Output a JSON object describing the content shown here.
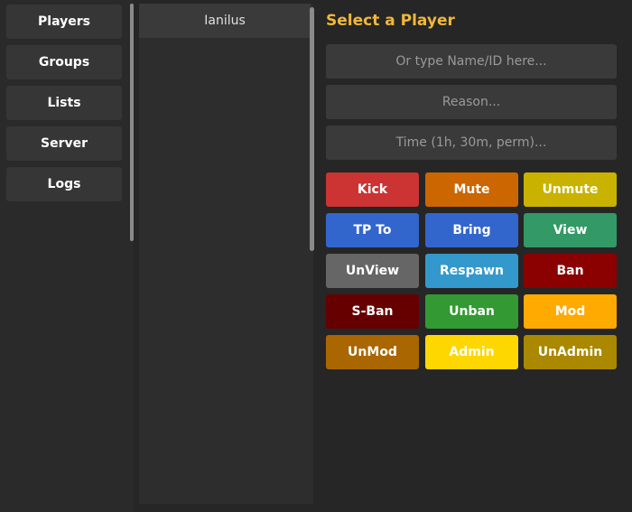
{
  "nav": {
    "players": "Players",
    "groups": "Groups",
    "lists": "Lists",
    "server": "Server",
    "logs": "Logs"
  },
  "players": [
    "Ianilus"
  ],
  "panel": {
    "title": "Select a Player",
    "target_placeholder": "Or type Name/ID here...",
    "reason_placeholder": "Reason...",
    "time_placeholder": "Time (1h, 30m, perm)..."
  },
  "actions": {
    "kick": "Kick",
    "mute": "Mute",
    "unmute": "Unmute",
    "tp_to": "TP To",
    "bring": "Bring",
    "view": "View",
    "unview": "UnView",
    "respawn": "Respawn",
    "ban": "Ban",
    "s_ban": "S-Ban",
    "unban": "Unban",
    "mod": "Mod",
    "unmod": "UnMod",
    "admin": "Admin",
    "unadmin": "UnAdmin"
  },
  "colors": {
    "title": "#f0b73a",
    "kick": "#cc3333",
    "mute": "#cc6600",
    "unmute": "#c9b200",
    "tp_to": "#3366cc",
    "bring": "#3366cc",
    "view": "#339966",
    "unview": "#666666",
    "respawn": "#3399cc",
    "ban": "#8b0000",
    "s_ban": "#660000",
    "unban": "#339933",
    "mod": "#ffaa00",
    "unmod": "#aa6600",
    "admin": "#ffd700",
    "unadmin": "#aa8800"
  }
}
